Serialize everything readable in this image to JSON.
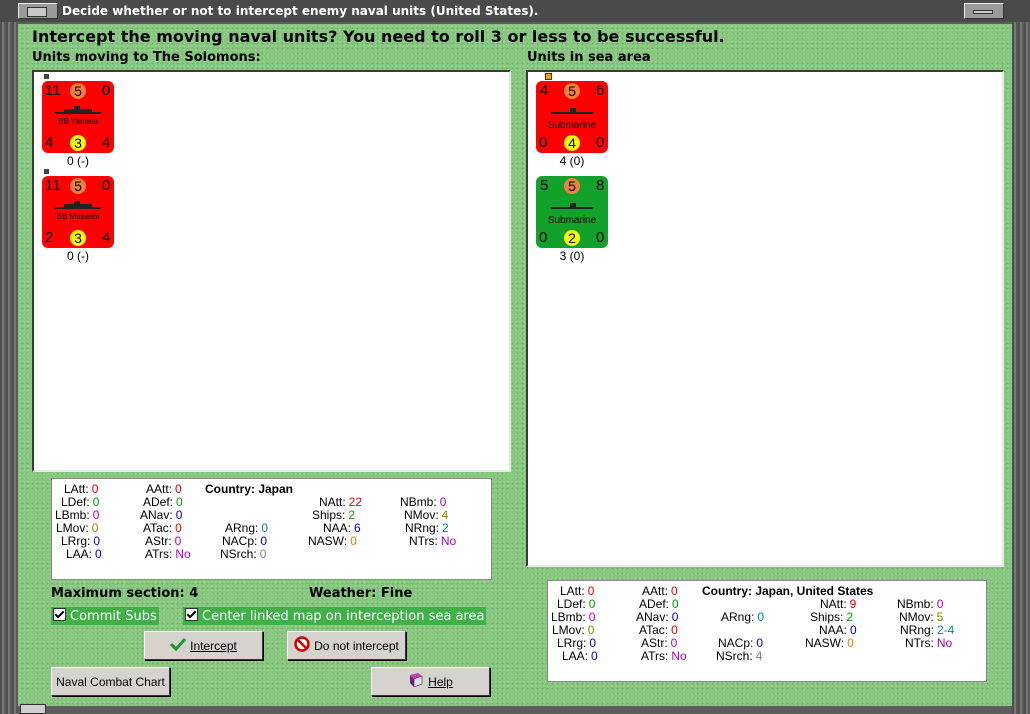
{
  "window": {
    "title": "Decide whether or not to intercept enemy naval units (United States)."
  },
  "question": "Intercept the moving naval units?  You need to roll 3 or less to be successful.",
  "left_section": {
    "label": "Units moving to The Solomons:",
    "units": [
      {
        "name": "BB Yamato",
        "tl": "11",
        "tc": "5",
        "tr": "0",
        "bl": "4",
        "bc": "3",
        "br": "4",
        "status": "0 (-)",
        "color": "#ff0000"
      },
      {
        "name": "BB Musashi",
        "tl": "11",
        "tc": "5",
        "tr": "0",
        "bl": "2",
        "bc": "3",
        "br": "4",
        "status": "0 (-)",
        "color": "#ff0000"
      }
    ]
  },
  "right_section": {
    "label": "Units in sea area",
    "units": [
      {
        "name": "Submarine",
        "tl": "4",
        "tc": "5",
        "tr": "6",
        "bl": "0",
        "bc": "4",
        "br": "0",
        "status": "4 (0)",
        "color": "#ff0000"
      },
      {
        "name": "Submarine",
        "tl": "5",
        "tc": "5",
        "tr": "8",
        "bl": "0",
        "bc": "2",
        "br": "0",
        "status": "3 (0)",
        "color": "#12a12a"
      }
    ]
  },
  "stats_left": {
    "country": "Country: Japan",
    "LAtt": "0",
    "LDef": "0",
    "LBmb": "0",
    "LMov": "0",
    "LRrg": "0",
    "LAA": "0",
    "AAtt": "0",
    "ADef": "0",
    "ANav": "0",
    "ATac": "0",
    "AStr": "0",
    "ATrs": "No",
    "ARng": "0",
    "NACp": "0",
    "NSrch": "0",
    "NAtt": "22",
    "Ships": "2",
    "NAA": "6",
    "NASW": "0",
    "NBmb": "0",
    "NMov": "4",
    "NRng": "2",
    "NTrs": "No"
  },
  "stats_right": {
    "country": "Country: Japan, United States",
    "LAtt": "0",
    "LDef": "0",
    "LBmb": "0",
    "LMov": "0",
    "LRrg": "0",
    "LAA": "0",
    "AAtt": "0",
    "ADef": "0",
    "ANav": "0",
    "ATac": "0",
    "AStr": "0",
    "ATrs": "No",
    "ARng": "0",
    "NACp": "0",
    "NSrch": "4",
    "NAtt": "9",
    "Ships": "2",
    "NAA": "0",
    "NASW": "0",
    "NBmb": "0",
    "NMov": "5",
    "NRng": "2-4",
    "NTrs": "No"
  },
  "info": {
    "max_section": "Maximum section: 4",
    "weather": "Weather:  Fine"
  },
  "checkboxes": {
    "commit_subs": "Commit Subs",
    "center_map": "Center linked map on interception sea area"
  },
  "buttons": {
    "intercept": "Intercept",
    "do_not_intercept": "Do not intercept",
    "naval_combat_chart": "Naval Combat Chart",
    "help": "Help"
  }
}
